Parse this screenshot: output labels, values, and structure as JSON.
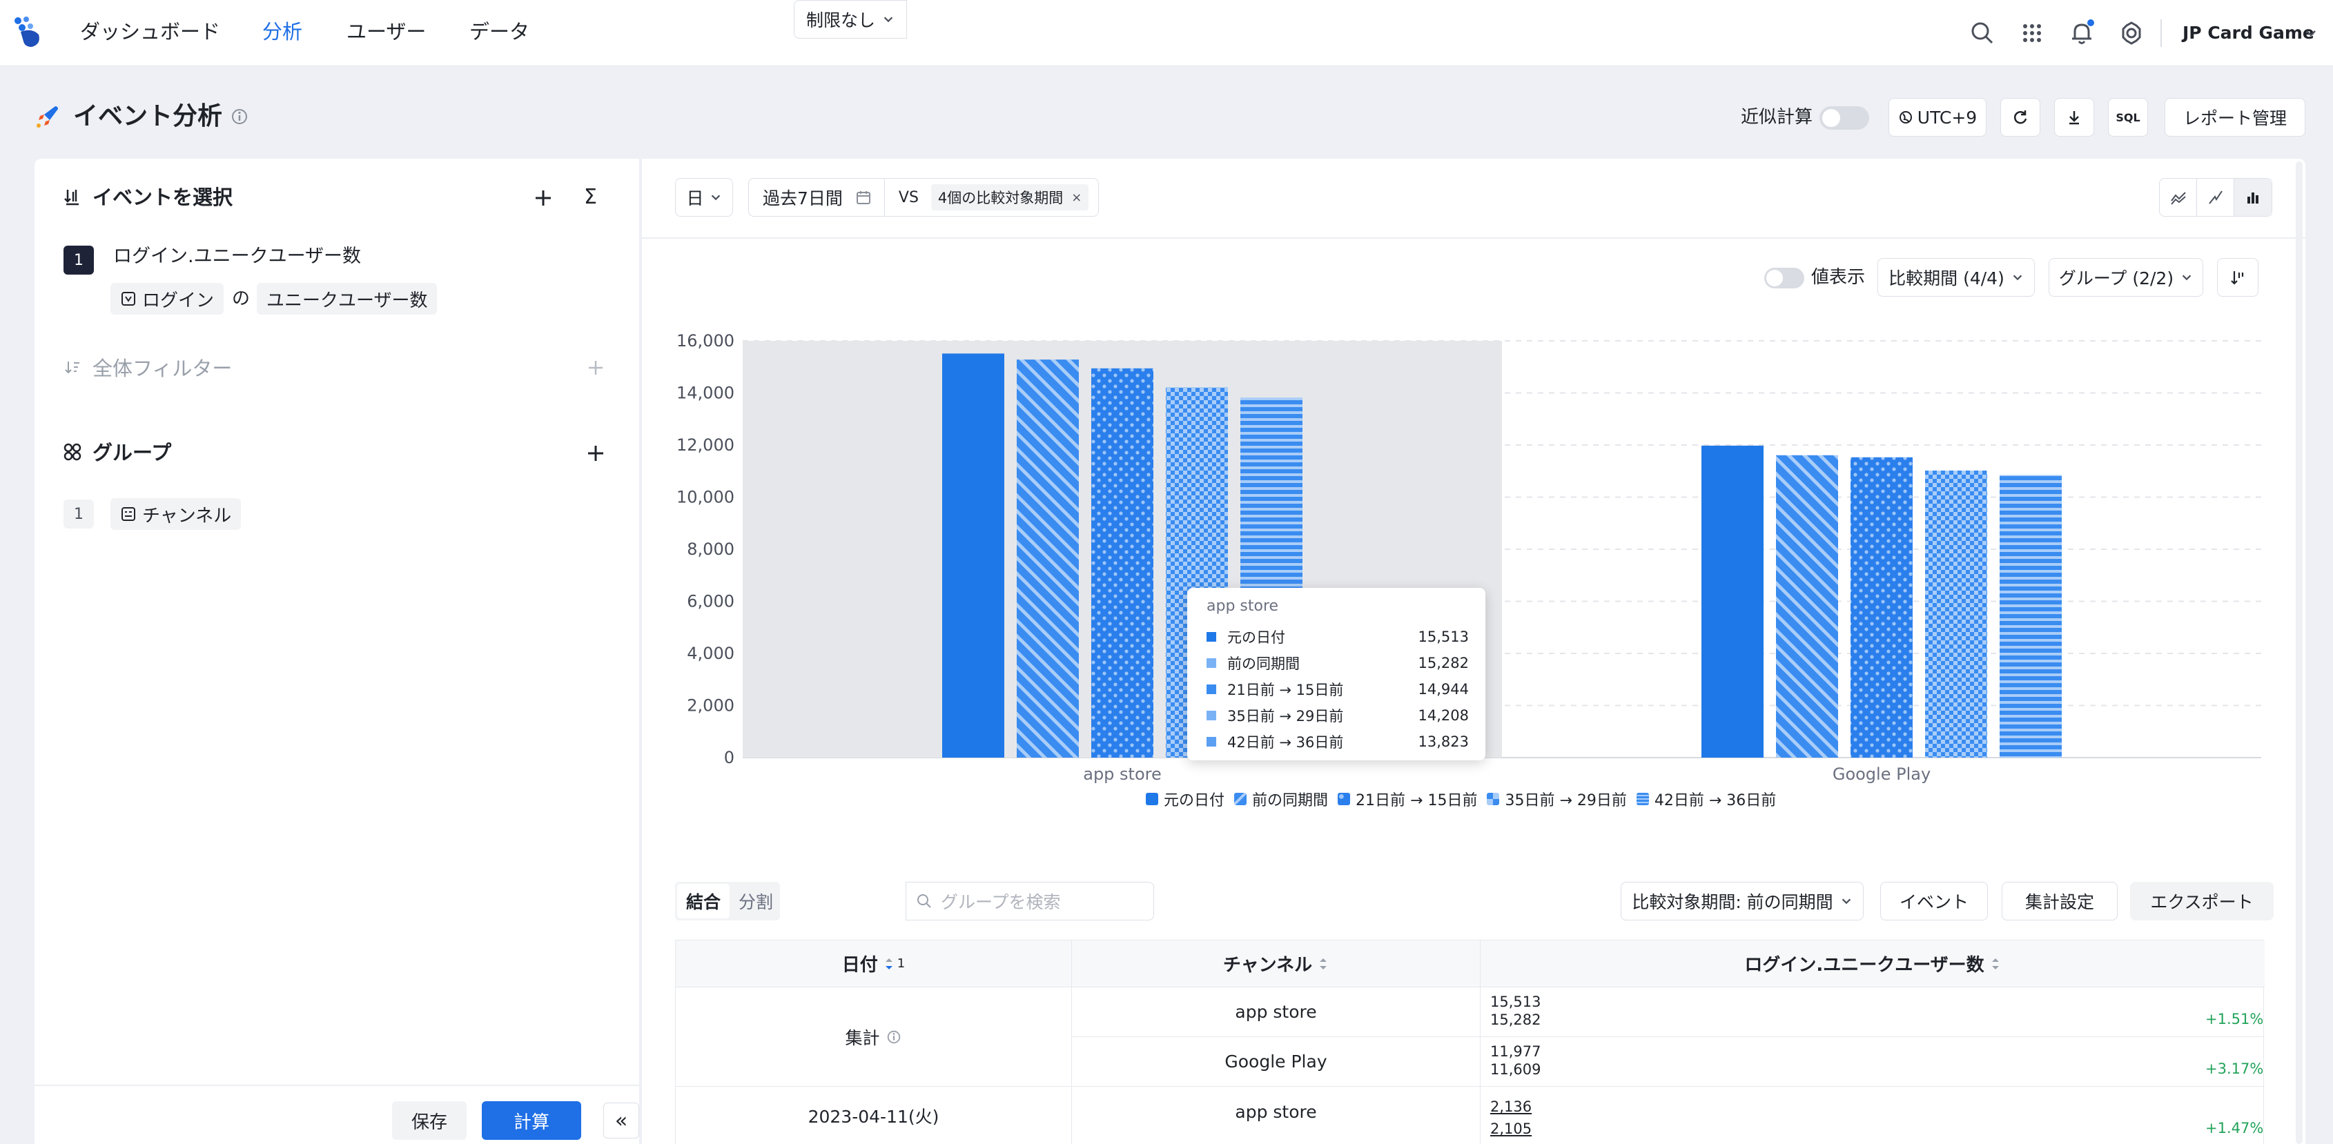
{
  "nav": {
    "items": [
      {
        "label": "ダッシュボード"
      },
      {
        "label": "分析"
      },
      {
        "label": "ユーザー"
      },
      {
        "label": "データ"
      }
    ],
    "org_name": "JP Card Game"
  },
  "header": {
    "title": "イベント分析",
    "approx_label": "近似計算",
    "approx_on": false,
    "timezone": "UTC+9",
    "sql_label": "SQL",
    "report_manage": "レポート管理"
  },
  "left": {
    "events_title": "イベントを選択",
    "sigma": "Σ",
    "event": {
      "index": "1",
      "name": "ログイン.ユニークユーザー数",
      "event_pill": "ログイン",
      "of": "の",
      "metric_pill": "ユニークユーザー数"
    },
    "filter_title": "全体フィルター",
    "group_title": "グループ",
    "group_item": {
      "index": "1",
      "name": "チャンネル"
    },
    "save": "保存",
    "compute": "計算",
    "collapse": "«"
  },
  "toolbar": {
    "granularity": "日",
    "range": "過去7日間",
    "vs": "VS",
    "compare_tag": "4個の比較対象期間",
    "tag_close": "×",
    "value_display": "値表示",
    "compare_select": "比較期間 (4/4)",
    "group_select": "グループ (2/2)"
  },
  "chart_data": {
    "type": "bar",
    "categories": [
      "app store",
      "Google Play"
    ],
    "series": [
      {
        "name": "元の日付",
        "values": [
          15513,
          11977
        ],
        "color": "#1f78e8"
      },
      {
        "name": "前の同期間",
        "values": [
          15282,
          11609
        ],
        "color": "#3a8cf0"
      },
      {
        "name": "21日前 → 15日前",
        "values": [
          14944,
          11530
        ],
        "color": "#2a7fec"
      },
      {
        "name": "35日前 → 29日前",
        "values": [
          14208,
          11020
        ],
        "color": "#3a8cf0"
      },
      {
        "name": "42日前 → 36日前",
        "values": [
          13823,
          10850
        ],
        "color": "#3a8cf0"
      }
    ],
    "ylim": [
      0,
      16000
    ],
    "yticks": [
      "0",
      "2,000",
      "4,000",
      "6,000",
      "8,000",
      "10,000",
      "12,000",
      "14,000",
      "16,000"
    ],
    "highlight_category": "app store",
    "legend_position": "bottom"
  },
  "tooltip": {
    "title": "app store",
    "rows": [
      {
        "label": "元の日付",
        "value": "15,513",
        "color": "#1f78e8"
      },
      {
        "label": "前の同期間",
        "value": "15,282",
        "color": "#7ab2f5"
      },
      {
        "label": "21日前 → 15日前",
        "value": "14,944",
        "color": "#3a8cf0"
      },
      {
        "label": "35日前 → 29日前",
        "value": "14,208",
        "color": "#7ab2f5"
      },
      {
        "label": "42日前 → 36日前",
        "value": "13,823",
        "color": "#5a9ff2"
      }
    ]
  },
  "table_toolbar": {
    "merge": "結合",
    "split": "分割",
    "limit": "制限なし",
    "search_placeholder": "グループを検索",
    "compare_period": "比較対象期間: 前の同期間",
    "event": "イベント",
    "agg_settings": "集計設定",
    "export": "エクスポート"
  },
  "table": {
    "headers": {
      "date": "日付",
      "date_sort_index": "1",
      "channel": "チャンネル",
      "metric": "ログイン.ユニークユーザー数"
    },
    "rows": [
      {
        "date": "集計",
        "channel": "app store",
        "value": "15,513",
        "prev": "15,282",
        "change": "+1.51%"
      },
      {
        "date": "",
        "channel": "Google Play",
        "value": "11,977",
        "prev": "11,609",
        "change": "+3.17%"
      },
      {
        "date": "2023-04-11(火)",
        "channel": "app store",
        "value": "2,136",
        "prev": "2,105",
        "change": "+1.47%"
      }
    ]
  }
}
